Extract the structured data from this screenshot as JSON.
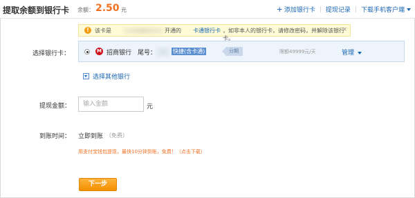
{
  "header": {
    "title": "提取余额到银行卡",
    "balance_label": "余额：",
    "balance_value": "2.50",
    "balance_unit": "元",
    "links": {
      "add_card": "添加银行卡",
      "records": "提现记录",
      "download": "下载手机客户端"
    }
  },
  "notice": {
    "part1": "该卡是",
    "part2": "开通的",
    "link": "卡通银行卡",
    "part3": "，如非本人的银行卡，请修改密码，并解除该银行卡。",
    "close": "×"
  },
  "form": {
    "card_label": "选择银行卡：",
    "bank_name": "招商银行",
    "tail_label": "尾号：",
    "quick_tag": "快捷(含卡通)",
    "arrow_tag": "分期",
    "limit_text": "限额49999元/天",
    "manage_label": "管理",
    "other_bank": "选择其他银行",
    "amount_label": "提现金额：",
    "amount_placeholder": "输入金额",
    "amount_unit": "元",
    "arrival_label": "到账时间：",
    "arrival_value": "立即到账",
    "arrival_free": "（免费）",
    "hint": "用支付宝钱包提现，最快10分钟到账，免费！（点击下载）",
    "next_button": "下一步"
  },
  "colors": {
    "accent_orange": "#f37021",
    "link_blue": "#1a66b3",
    "notice_bg": "#fffbd6",
    "bank_row_bg": "#eef4fb",
    "button_orange": "#f39000"
  },
  "icons": [
    "plus-icon",
    "chevron-down-icon",
    "warning-icon",
    "close-icon",
    "cmb-bank-logo-icon",
    "radio-icon"
  ]
}
